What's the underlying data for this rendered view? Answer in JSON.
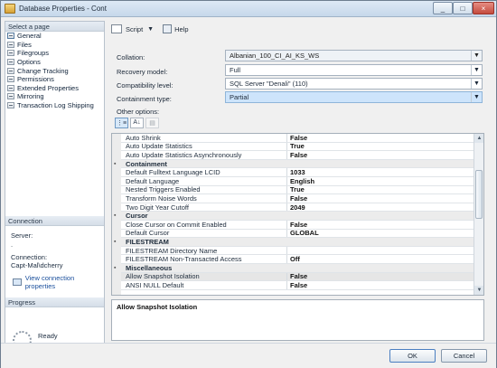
{
  "window": {
    "title": "Database Properties - Cont",
    "controls": [
      "_",
      "□",
      "×"
    ]
  },
  "left_pane": {
    "pages_header": "Select a page",
    "pages": [
      "General",
      "Files",
      "Filegroups",
      "Options",
      "Change Tracking",
      "Permissions",
      "Extended Properties",
      "Mirroring",
      "Transaction Log Shipping"
    ],
    "connection_header": "Connection",
    "server_label": "Server:",
    "server_value": ".",
    "connection_label": "Connection:",
    "connection_value": "Capt-Mal\\dcherry",
    "view_connection_properties": "View connection properties",
    "progress_header": "Progress",
    "progress_status": "Ready"
  },
  "toolbar": {
    "script_label": "Script",
    "help_label": "Help"
  },
  "form": {
    "collation_label": "Collation:",
    "collation_value": "Albanian_100_CI_AI_KS_WS",
    "recovery_label": "Recovery model:",
    "recovery_value": "Full",
    "compat_label": "Compatibility level:",
    "compat_value": "SQL Server \"Denali\" (110)",
    "containment_label": "Containment type:",
    "containment_value": "Partial",
    "other_options_label": "Other options:"
  },
  "grid_buttons": [
    "⋮≡",
    "A↓",
    "▤"
  ],
  "properties": [
    {
      "type": "row",
      "name": "Auto Shrink",
      "value": "False"
    },
    {
      "type": "row",
      "name": "Auto Update Statistics",
      "value": "True"
    },
    {
      "type": "row",
      "name": "Auto Update Statistics Asynchronously",
      "value": "False"
    },
    {
      "type": "group",
      "name": "Containment"
    },
    {
      "type": "row",
      "name": "Default Fulltext Language LCID",
      "value": "1033"
    },
    {
      "type": "row",
      "name": "Default Language",
      "value": "English"
    },
    {
      "type": "row",
      "name": "Nested Triggers Enabled",
      "value": "True"
    },
    {
      "type": "row",
      "name": "Transform Noise Words",
      "value": "False"
    },
    {
      "type": "row",
      "name": "Two Digit Year Cutoff",
      "value": "2049"
    },
    {
      "type": "group",
      "name": "Cursor"
    },
    {
      "type": "row",
      "name": "Close Cursor on Commit Enabled",
      "value": "False"
    },
    {
      "type": "row",
      "name": "Default Cursor",
      "value": "GLOBAL"
    },
    {
      "type": "group",
      "name": "FILESTREAM"
    },
    {
      "type": "row",
      "name": "FILESTREAM Directory Name",
      "value": ""
    },
    {
      "type": "row",
      "name": "FILESTREAM Non-Transacted Access",
      "value": "Off"
    },
    {
      "type": "group",
      "name": "Miscellaneous"
    },
    {
      "type": "row",
      "name": "Allow Snapshot Isolation",
      "value": "False",
      "selected": true
    },
    {
      "type": "row",
      "name": "ANSI NULL Default",
      "value": "False"
    }
  ],
  "description": "Allow Snapshot Isolation",
  "buttons": {
    "ok": "OK",
    "cancel": "Cancel"
  }
}
